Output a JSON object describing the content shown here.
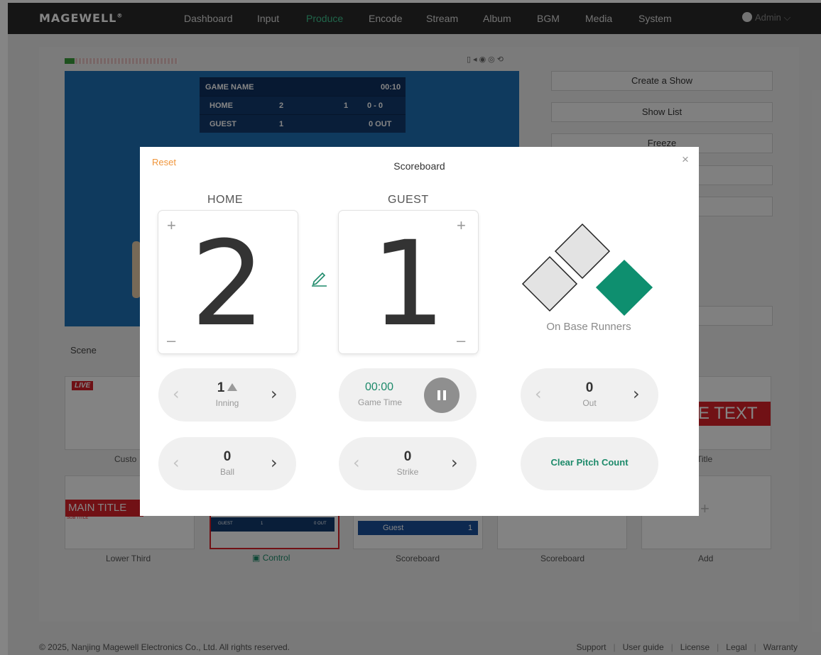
{
  "nav": {
    "logo": "MAGEWELL",
    "items": [
      "Dashboard",
      "Input",
      "Produce",
      "Encode",
      "Stream",
      "Album",
      "BGM",
      "Media",
      "System"
    ],
    "active": "Produce",
    "user": "Admin"
  },
  "preview": {
    "scoreboard": {
      "game_name": "GAME NAME",
      "clock": "00:10",
      "home_label": "HOME",
      "home_score": "2",
      "guest_label": "GUEST",
      "guest_score": "1",
      "inning": "1",
      "count": "0 - 0",
      "outs": "0 OUT"
    }
  },
  "right_panel": {
    "buttons": [
      "Create a Show",
      "Show List",
      "Freeze"
    ]
  },
  "scene": {
    "label": "Scene",
    "cards": [
      {
        "caption": "Custo",
        "badge": "LIVE"
      },
      {
        "caption": "Title",
        "text": "E TEXT"
      },
      {
        "caption": "Lower Third",
        "title": "MAIN TITLE",
        "subtitle": "SUB TITLE"
      },
      {
        "caption": "Control",
        "mini_guest": "GUEST",
        "mini_guest_score": "1",
        "mini_outs": "0 OUT"
      },
      {
        "caption": "Scoreboard",
        "team": "Guest",
        "score": "1"
      },
      {
        "caption": "Scoreboard"
      },
      {
        "caption": "Add"
      }
    ]
  },
  "footer": {
    "copyright": "© 2025, Nanjing Magewell Electronics Co., Ltd. All rights reserved.",
    "links": [
      "Support",
      "User guide",
      "License",
      "Legal",
      "Warranty"
    ]
  },
  "modal": {
    "reset": "Reset",
    "title": "Scoreboard",
    "close": "×",
    "home": {
      "label": "HOME",
      "score": "2"
    },
    "guest": {
      "label": "GUEST",
      "score": "1"
    },
    "runners_label": "On Base Runners",
    "runners": {
      "first": true,
      "second": false,
      "third": false
    },
    "inning": {
      "value": "1",
      "label": "Inning"
    },
    "game_time": {
      "value": "00:00",
      "label": "Game Time"
    },
    "out": {
      "value": "0",
      "label": "Out"
    },
    "ball": {
      "value": "0",
      "label": "Ball"
    },
    "strike": {
      "value": "0",
      "label": "Strike"
    },
    "clear_label": "Clear Pitch Count",
    "colors": {
      "accent": "#1d8a6a",
      "reset": "#f0963c",
      "base_on": "#0e8f6f"
    }
  }
}
